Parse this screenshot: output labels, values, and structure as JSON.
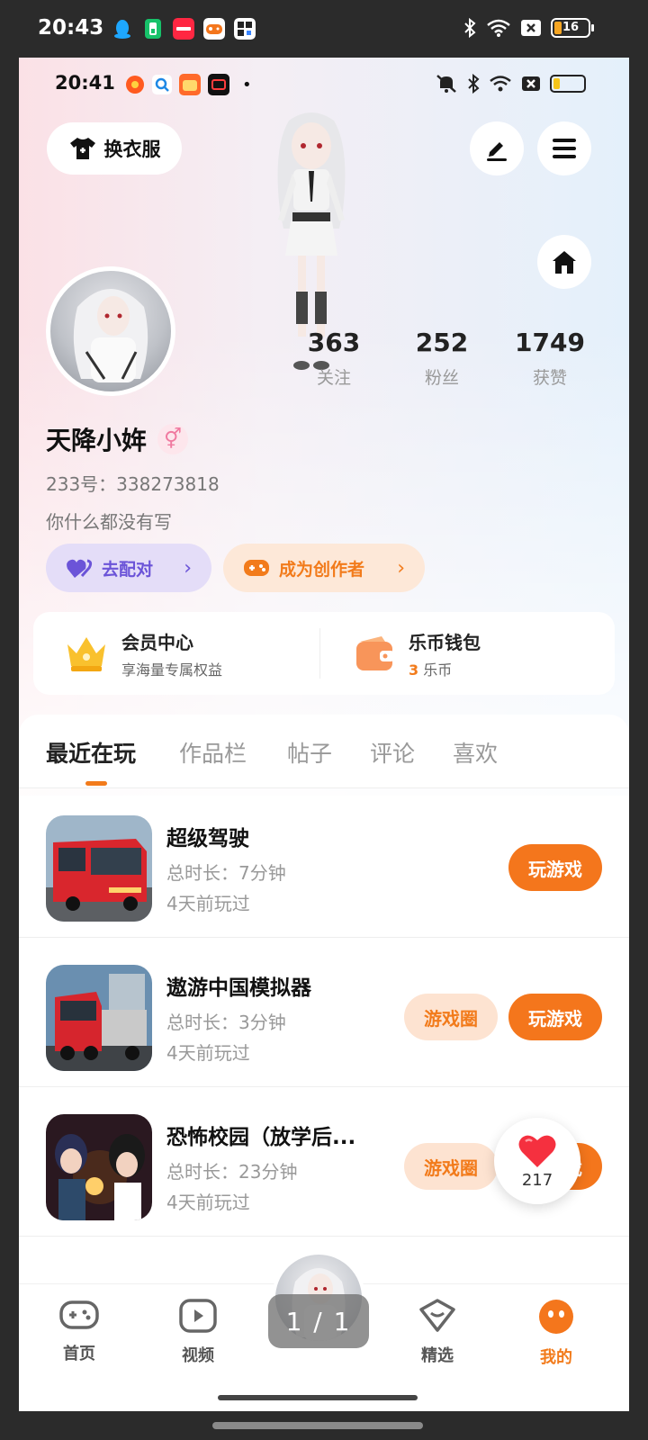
{
  "outer_status": {
    "time": "20:43",
    "battery": "16",
    "app_icons": [
      "qq-icon",
      "battery-app-icon",
      "xiaohongshu-icon",
      "game-app-icon",
      "qr-app-icon"
    ]
  },
  "inner_status": {
    "time": "20:41",
    "dot": "•"
  },
  "header": {
    "change_clothes": "换衣服"
  },
  "stats": [
    {
      "value": "363",
      "label": "关注"
    },
    {
      "value": "252",
      "label": "粉丝"
    },
    {
      "value": "1749",
      "label": "获赞"
    }
  ],
  "profile": {
    "name": "天降小姩",
    "gender_symbol": "⚥",
    "uid": "233号：338273818",
    "bio": "你什么都没有写"
  },
  "actions": {
    "match": "去配对",
    "creator": "成为创作者"
  },
  "features": {
    "vip_title": "会员中心",
    "vip_sub": "享海量专属权益",
    "wallet_title": "乐币钱包",
    "wallet_amount": "3",
    "wallet_unit": "乐币"
  },
  "tabs": [
    "最近在玩",
    "作品栏",
    "帖子",
    "评论",
    "喜欢"
  ],
  "games": [
    {
      "title": "超级驾驶",
      "duration": "总时长：7分钟",
      "last_played": "4天前玩过",
      "play": "玩游戏"
    },
    {
      "title": "遨游中国模拟器",
      "duration": "总时长：3分钟",
      "last_played": "4天前玩过",
      "circle": "游戏圈",
      "play": "玩游戏"
    },
    {
      "title": "恐怖校园（放学后...",
      "duration": "总时长：23分钟",
      "last_played": "4天前玩过",
      "circle": "游戏圈",
      "play": "玩游戏"
    }
  ],
  "like_bubble": {
    "count": "217"
  },
  "bottom_nav": {
    "home": "首页",
    "video": "视频",
    "featured": "精选",
    "mine": "我的"
  },
  "page_indicator": "1 / 1",
  "colors": {
    "accent": "#f4761c",
    "match": "#6b54d8",
    "gender": "#f07aa0"
  }
}
